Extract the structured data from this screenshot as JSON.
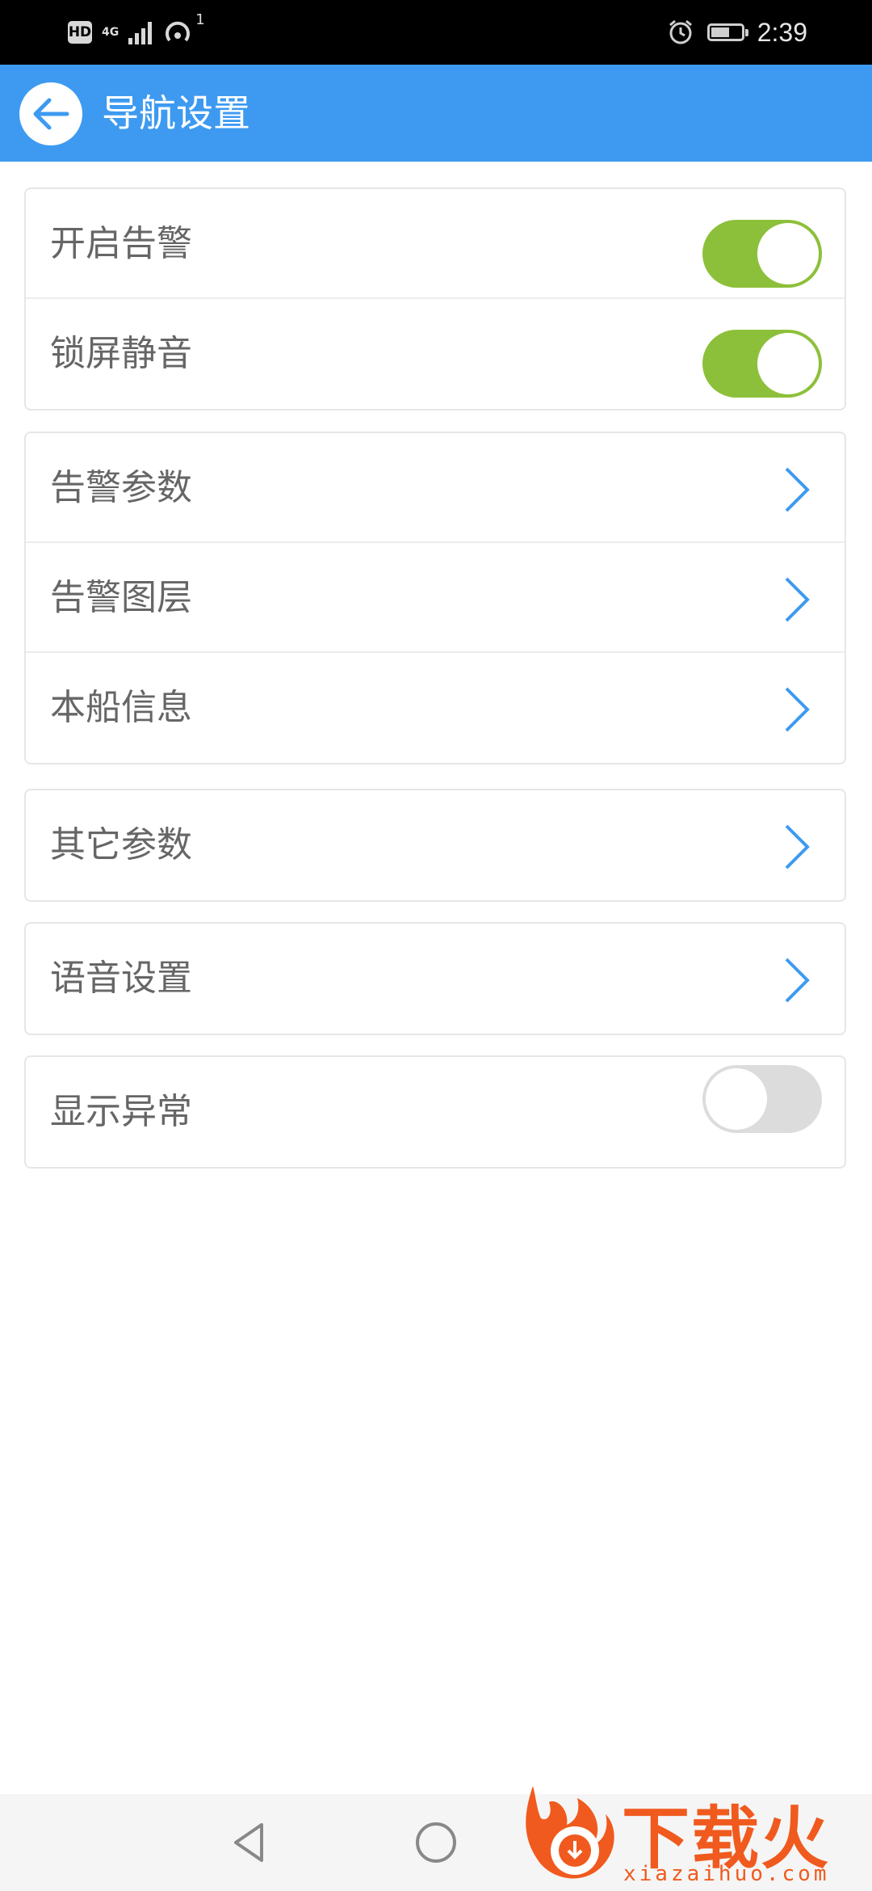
{
  "status_bar": {
    "hd": "HD",
    "network": "4G",
    "hotspot_count": "1",
    "time": "2:39",
    "battery_level": 0.6
  },
  "app_bar": {
    "title": "导航设置",
    "color": "#3d9af0"
  },
  "groups": [
    {
      "rows": [
        {
          "label": "开启告警",
          "control": "toggle",
          "on": true
        },
        {
          "label": "锁屏静音",
          "control": "toggle",
          "on": true
        }
      ]
    },
    {
      "rows": [
        {
          "label": "告警参数",
          "control": "chevron-right-icon"
        },
        {
          "label": "告警图层",
          "control": "chevron-right-icon"
        },
        {
          "label": "本船信息",
          "control": "chevron-right-icon"
        }
      ]
    },
    {
      "rows": [
        {
          "label": "其它参数",
          "control": "chevron-right-icon"
        }
      ]
    },
    {
      "rows": [
        {
          "label": "语音设置",
          "control": "chevron-right-icon"
        }
      ]
    },
    {
      "rows": [
        {
          "label": "显示异常",
          "control": "toggle",
          "on": false
        }
      ]
    }
  ],
  "colors": {
    "toggle_on": "#8dc03a",
    "toggle_off": "#dcdcdc",
    "chevron": "#3d9af0"
  },
  "watermark": {
    "brand": "下载火",
    "domain": "xiazaihuo.com"
  }
}
